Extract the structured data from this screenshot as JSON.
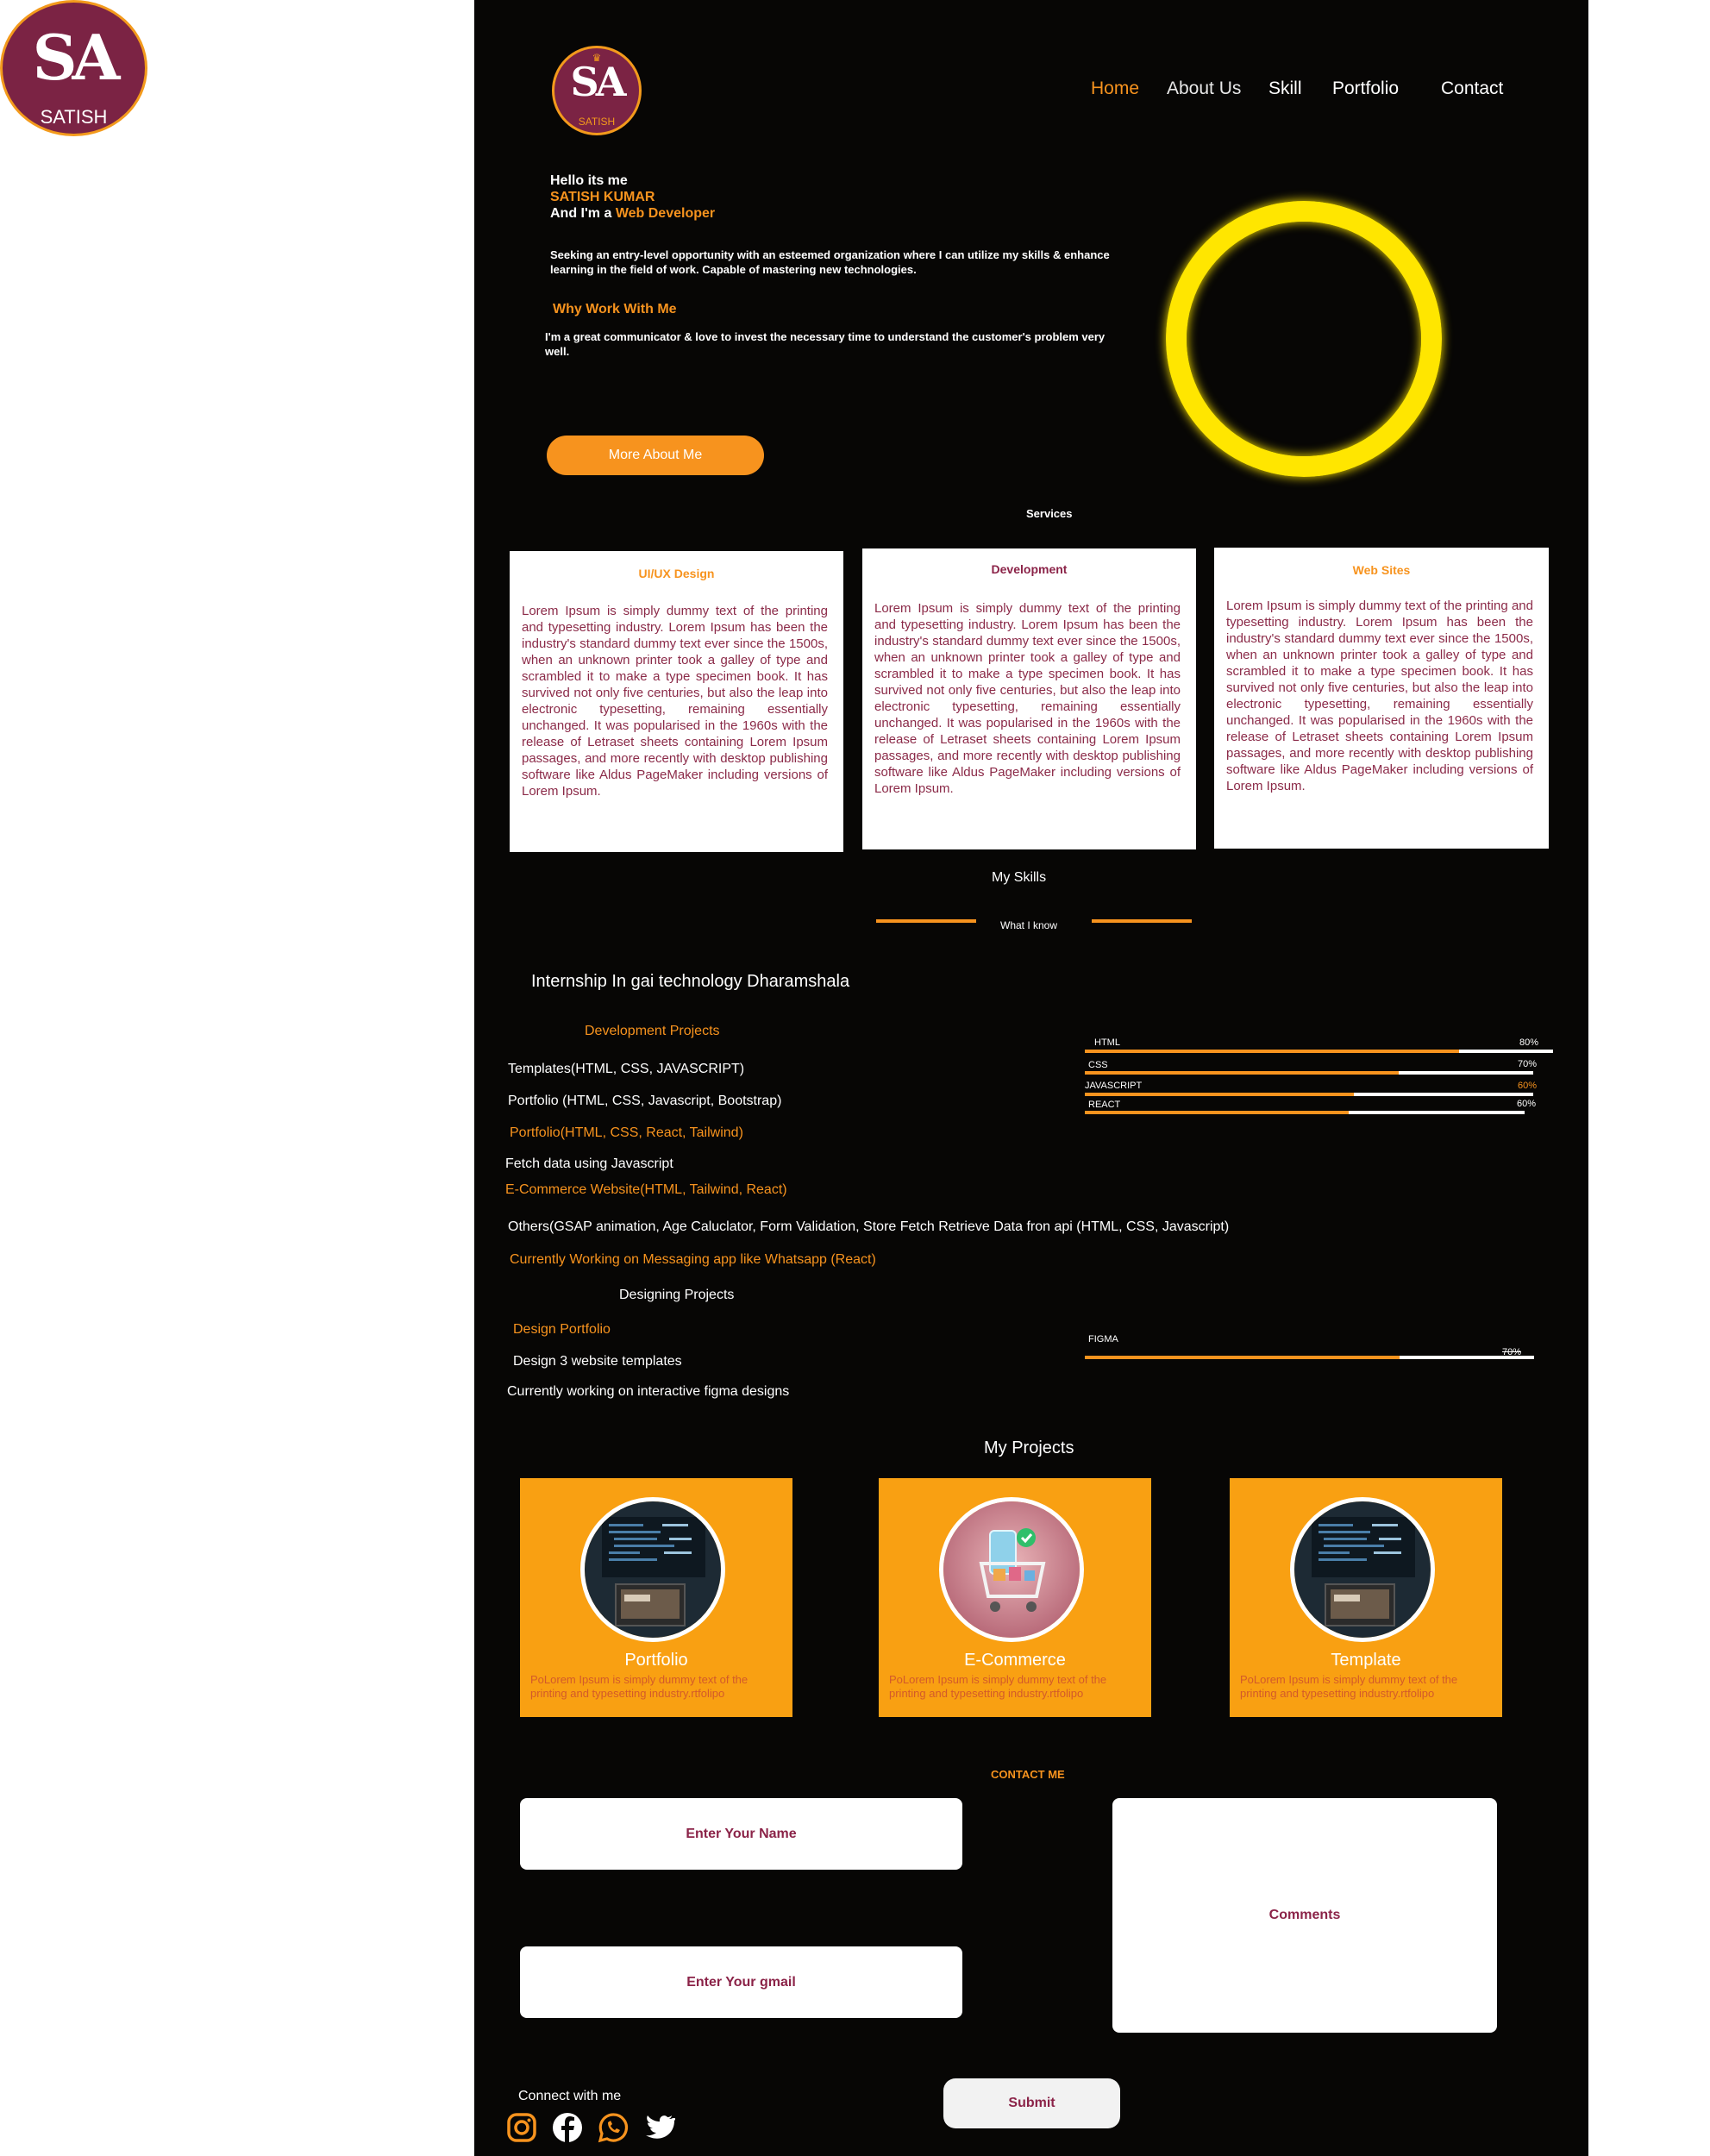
{
  "corner_logo": {
    "monogram": "SA",
    "name": "SATISH"
  },
  "nav": {
    "logo": {
      "monogram": "SA",
      "name": "SATISH"
    },
    "links": [
      "Home",
      "About Us",
      "Skill",
      "Portfolio",
      "Contact"
    ]
  },
  "hero": {
    "greeting": "Hello its me",
    "name": "SATISH KUMAR",
    "role_prefix": "And I'm a ",
    "role": "Web Developer",
    "objective": "Seeking an entry-level opportunity with an esteemed organization where I can utilize my skills & enhance learning in the field of work. Capable of mastering new technologies.",
    "why_title": "Why Work With Me",
    "why_text": "I'm a great communicator & love to invest the necessary time to understand the customer's problem very well.",
    "cta": "More About Me"
  },
  "services": {
    "heading": "Services",
    "cards": [
      {
        "title": "UI/UX Design",
        "title_color": "#f7931e",
        "text": "Lorem Ipsum is simply dummy text of the printing and typesetting industry. Lorem Ipsum has been the industry's standard dummy text ever since the 1500s, when an unknown printer took a galley of type and scrambled it to make a type specimen book. It has survived not only five centuries, but also the leap into electronic typesetting, remaining essentially unchanged. It was popularised in the 1960s with the release of Letraset sheets containing Lorem Ipsum passages, and more recently with desktop publishing software like Aldus PageMaker including versions of Lorem Ipsum."
      },
      {
        "title": "Development",
        "title_color": "#8b2348",
        "text": "Lorem Ipsum is simply dummy text of the printing and typesetting industry. Lorem Ipsum has been the industry's standard dummy text ever since the 1500s, when an unknown printer took a galley of type and scrambled it to make a type specimen book. It has survived not only five centuries, but also the leap into electronic typesetting, remaining essentially unchanged. It was popularised in the 1960s with the release of Letraset sheets containing Lorem Ipsum passages, and more recently with desktop publishing software like Aldus PageMaker including versions of Lorem Ipsum."
      },
      {
        "title": "Web Sites",
        "title_color": "#f7931e",
        "text": "Lorem Ipsum is simply dummy text of the printing and typesetting industry. Lorem Ipsum has been the industry's standard dummy text ever since the 1500s, when an unknown printer took a galley of type and scrambled it to make a type specimen book. It has survived not only five centuries, but also the leap into electronic typesetting, remaining essentially unchanged. It was popularised in the 1960s with the release of Letraset sheets containing Lorem Ipsum passages, and more recently with desktop publishing software like Aldus PageMaker including versions of Lorem Ipsum."
      }
    ]
  },
  "skills": {
    "heading": "My Skills",
    "subheading": "What I know",
    "internship": "Internship In gai technology Dharamshala",
    "dev_title": "Development Projects",
    "dev_items": [
      "Templates(HTML, CSS, JAVASCRIPT)",
      "Portfolio (HTML, CSS, Javascript, Bootstrap)",
      "Portfolio(HTML, CSS, React, Tailwind)",
      "Fetch data using Javascript",
      "E-Commerce Website(HTML, Tailwind, React)",
      "Others(GSAP animation, Age Caluclator, Form Validation, Store Fetch Retrieve Data fron api (HTML, CSS, Javascript)",
      "Currently Working on Messaging app like Whatsapp (React)"
    ],
    "design_title": "Designing Projects",
    "design_items": [
      "Design Portfolio",
      "Design 3 website templates",
      "Currently working on interactive figma designs"
    ],
    "bars": [
      {
        "label": "HTML",
        "pct_text": "80%",
        "level": 0.8
      },
      {
        "label": "CSS",
        "pct_text": "70%",
        "level": 0.7
      },
      {
        "label": "JAVASCRIPT",
        "pct_text": "60%",
        "level": 0.6
      },
      {
        "label": "REACT",
        "pct_text": "60%",
        "level": 0.6
      },
      {
        "label": "FIGMA",
        "pct_text": "70%",
        "level": 0.7
      }
    ]
  },
  "projects": {
    "heading": "My Projects",
    "items": [
      {
        "title": "Portfolio",
        "desc": "PoLorem Ipsum is simply dummy text of the printing and typesetting industry.rtfolipo",
        "image": "code-screen-image"
      },
      {
        "title": "E-Commerce",
        "desc": "PoLorem Ipsum is simply dummy text of the printing and typesetting industry.rtfolipo",
        "image": "shopping-cart-image"
      },
      {
        "title": "Template",
        "desc": "PoLorem Ipsum is simply dummy text of the printing and typesetting industry.rtfolipo",
        "image": "code-screen-image"
      }
    ]
  },
  "contact": {
    "heading": "CONTACT ME",
    "name_placeholder": "Enter Your Name",
    "email_placeholder": "Enter Your gmail",
    "comments_placeholder": "Comments",
    "submit": "Submit",
    "connect": "Connect with me",
    "socials": [
      "instagram-icon",
      "facebook-icon",
      "whatsapp-icon",
      "twitter-icon"
    ]
  },
  "colors": {
    "accent": "#f7931e",
    "brand": "#7b2344",
    "ring": "#ffe600",
    "background": "#070605",
    "project_card": "#f9a012"
  }
}
